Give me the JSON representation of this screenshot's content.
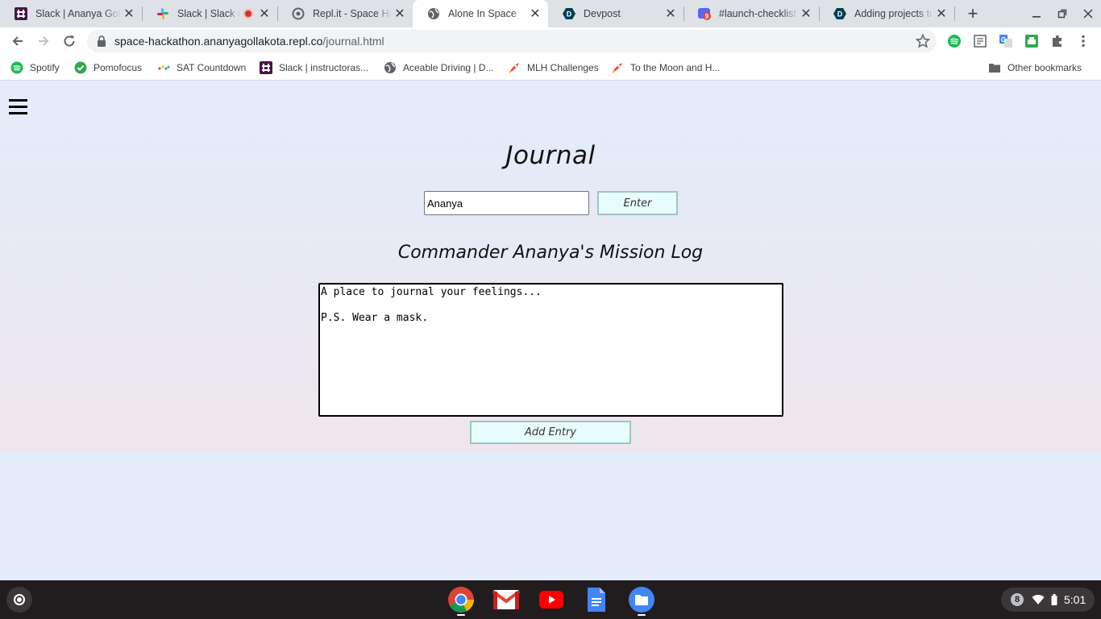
{
  "browser": {
    "tabs": [
      {
        "title": "Slack | Ananya Gollakota",
        "icon": "slack-workspace-icon"
      },
      {
        "title": "Slack | Slack call",
        "icon": "slack-icon",
        "recording": true
      },
      {
        "title": "Repl.it - Space Hackathon",
        "icon": "replit-icon"
      },
      {
        "title": "Alone In Space",
        "icon": "globe-icon",
        "active": true
      },
      {
        "title": "Devpost",
        "icon": "devpost-icon"
      },
      {
        "title": "#launch-checklist",
        "icon": "discord-icon",
        "badge": "9"
      },
      {
        "title": "Adding projects to",
        "icon": "devpost-icon"
      }
    ],
    "url": {
      "host": "space-hackathon.ananyagollakota.repl.co",
      "path": "/journal.html"
    },
    "bookmarks": [
      {
        "label": "Spotify",
        "icon": "spotify-icon"
      },
      {
        "label": "Pomofocus",
        "icon": "check-circle-icon"
      },
      {
        "label": "SAT Countdown",
        "icon": "dots-icon"
      },
      {
        "label": "Slack | instructoras...",
        "icon": "slack-workspace-icon"
      },
      {
        "label": "Aceable Driving | D...",
        "icon": "globe-icon"
      },
      {
        "label": "MLH Challenges",
        "icon": "rocket-icon"
      },
      {
        "label": "To the Moon and H...",
        "icon": "rocket-icon"
      }
    ],
    "other_bookmarks": "Other bookmarks"
  },
  "page": {
    "title": "Journal",
    "name_value": "Ananya",
    "enter_label": "Enter",
    "log_title": "Commander Ananya's Mission Log",
    "entry_text": "A place to journal your feelings...\n\nP.S. Wear a mask.",
    "add_entry_label": "Add Entry"
  },
  "shelf": {
    "apps": [
      "chrome-icon",
      "gmail-icon",
      "youtube-icon",
      "docs-icon",
      "files-icon"
    ],
    "notification_count": "8",
    "time": "5:01"
  },
  "colors": {
    "page_bg": "#e2ecfb",
    "button_bg": "#e7fdfb",
    "button_border": "#9ec5c2",
    "shelf_bg": "#211d1f"
  }
}
